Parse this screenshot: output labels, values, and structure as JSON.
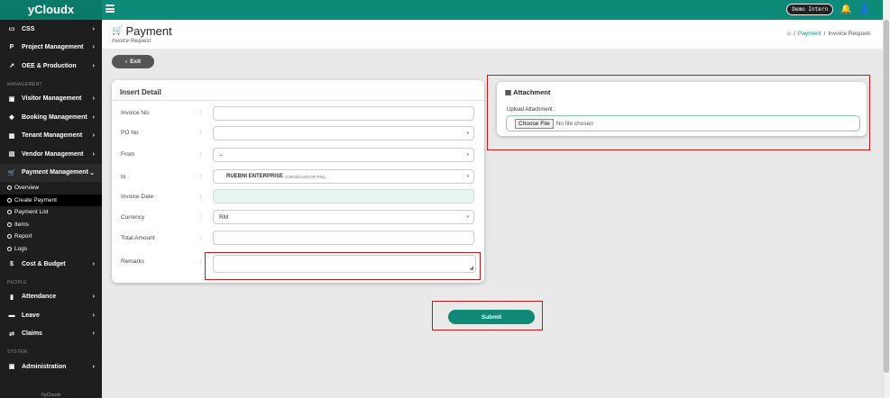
{
  "app": {
    "brand": "yCloudx",
    "badge": "Demo Intern"
  },
  "sidebar": {
    "items": [
      {
        "icon": "▭",
        "label": "CSS"
      },
      {
        "icon": "P",
        "label": "Project Management"
      },
      {
        "icon": "↗",
        "label": "OEE & Production"
      }
    ],
    "section_management": "MANAGEMENT",
    "mgmt_items": [
      {
        "icon": "▣",
        "label": "Visitor Management"
      },
      {
        "icon": "◆",
        "label": "Booking Management"
      },
      {
        "icon": "▦",
        "label": "Tenant Management"
      },
      {
        "icon": "▤",
        "label": "Vendor Management"
      },
      {
        "icon": "🛒",
        "label": "Payment Management"
      }
    ],
    "payment_sub": [
      "Overview",
      "Create Payment",
      "Payment List",
      "Items",
      "Report",
      "Logs"
    ],
    "cost_item": {
      "icon": "$",
      "label": "Cost & Budget"
    },
    "section_people": "PEOPLE",
    "people_items": [
      {
        "icon": "▮",
        "label": "Attendance"
      },
      {
        "icon": "▬",
        "label": "Leave"
      },
      {
        "icon": "⇄",
        "label": "Claims"
      }
    ],
    "section_system": "SYSTEM",
    "system_items": [
      {
        "icon": "▣",
        "label": "Administration"
      }
    ],
    "footer": "©yCloudx"
  },
  "page": {
    "title": "Payment",
    "subtitle": "Invoice Request",
    "breadcrumb": {
      "sep": "/",
      "link": "Payment",
      "current": "Invoice Request"
    },
    "exit_label": "Exit"
  },
  "detail": {
    "title": "Insert Detail",
    "colon": ":",
    "invoice_no": {
      "label": "Invoice No.",
      "value": ""
    },
    "po_no": {
      "label": "PO No",
      "value": ""
    },
    "from": {
      "label": "From",
      "value": "--"
    },
    "to": {
      "label": "to",
      "value_main": "RUEBNI ENTERPRISE",
      "value_sub": "(AIRSELANGOR-P54)"
    },
    "invoice_date": {
      "label": "Invoice Date",
      "value": ""
    },
    "currency": {
      "label": "Currency",
      "value": "RM"
    },
    "total_amount": {
      "label": "Total Amount",
      "value": ""
    },
    "remarks": {
      "label": "Remarks",
      "value": ""
    }
  },
  "attachment": {
    "title": "Attachment",
    "upload_label": "Upload Attachment :",
    "choose_label": "Choose File",
    "no_file": "No file chosen"
  },
  "submit_label": "Submit"
}
